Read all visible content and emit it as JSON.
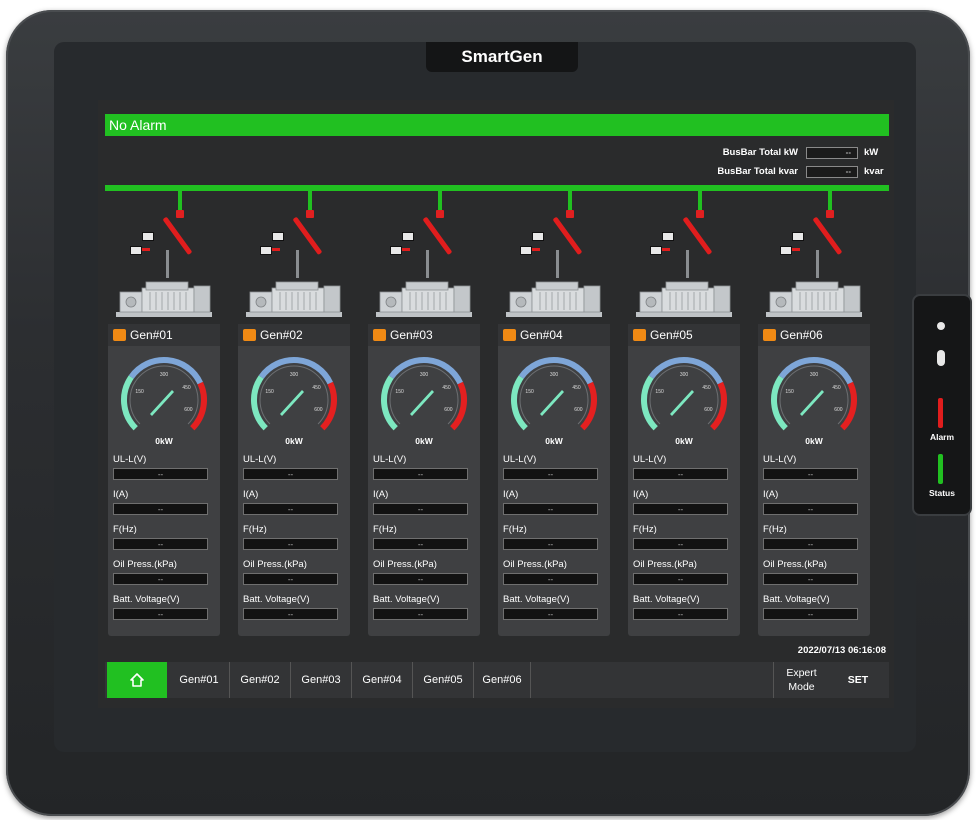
{
  "device": {
    "brand": "SmartGen",
    "side_panel": {
      "alarm_label": "Alarm",
      "status_label": "Status",
      "alarm_color": "#e01d1d",
      "status_color": "#21c021"
    }
  },
  "screen": {
    "alarm_status": "No Alarm",
    "busbar": {
      "total_kw_label": "BusBar Total kW",
      "total_kw_value": "--",
      "total_kw_unit": "kW",
      "total_kvar_label": "BusBar Total kvar",
      "total_kvar_value": "--",
      "total_kvar_unit": "kvar"
    },
    "gauge_ticks": [
      "150",
      "300",
      "450",
      "600"
    ],
    "generators": [
      {
        "name": "Gen#01",
        "power": "0kW",
        "voltage_label": "UL-L(V)",
        "voltage": "--",
        "current_label": "I(A)",
        "current": "--",
        "freq_label": "F(Hz)",
        "freq": "--",
        "oil_label": "Oil Press.(kPa)",
        "oil": "--",
        "batt_label": "Batt. Voltage(V)",
        "batt": "--"
      },
      {
        "name": "Gen#02",
        "power": "0kW",
        "voltage_label": "UL-L(V)",
        "voltage": "--",
        "current_label": "I(A)",
        "current": "--",
        "freq_label": "F(Hz)",
        "freq": "--",
        "oil_label": "Oil Press.(kPa)",
        "oil": "--",
        "batt_label": "Batt. Voltage(V)",
        "batt": "--"
      },
      {
        "name": "Gen#03",
        "power": "0kW",
        "voltage_label": "UL-L(V)",
        "voltage": "--",
        "current_label": "I(A)",
        "current": "--",
        "freq_label": "F(Hz)",
        "freq": "--",
        "oil_label": "Oil Press.(kPa)",
        "oil": "--",
        "batt_label": "Batt. Voltage(V)",
        "batt": "--"
      },
      {
        "name": "Gen#04",
        "power": "0kW",
        "voltage_label": "UL-L(V)",
        "voltage": "--",
        "current_label": "I(A)",
        "current": "--",
        "freq_label": "F(Hz)",
        "freq": "--",
        "oil_label": "Oil Press.(kPa)",
        "oil": "--",
        "batt_label": "Batt. Voltage(V)",
        "batt": "--"
      },
      {
        "name": "Gen#05",
        "power": "0kW",
        "voltage_label": "UL-L(V)",
        "voltage": "--",
        "current_label": "I(A)",
        "current": "--",
        "freq_label": "F(Hz)",
        "freq": "--",
        "oil_label": "Oil Press.(kPa)",
        "oil": "--",
        "batt_label": "Batt. Voltage(V)",
        "batt": "--"
      },
      {
        "name": "Gen#06",
        "power": "0kW",
        "voltage_label": "UL-L(V)",
        "voltage": "--",
        "current_label": "I(A)",
        "current": "--",
        "freq_label": "F(Hz)",
        "freq": "--",
        "oil_label": "Oil Press.(kPa)",
        "oil": "--",
        "batt_label": "Batt. Voltage(V)",
        "batt": "--"
      }
    ],
    "timestamp": "2022/07/13 06:16:08",
    "nav": {
      "home_icon": "home-icon",
      "tabs": [
        "Gen#01",
        "Gen#02",
        "Gen#03",
        "Gen#04",
        "Gen#05",
        "Gen#06"
      ],
      "expert_mode": "Expert Mode",
      "set": "SET"
    },
    "colors": {
      "accent": "#21c021",
      "alarm_red": "#e01d1d",
      "gauge_green": "#7de8c0",
      "gauge_blue": "#7ea6d8",
      "gauge_red": "#e42020",
      "gen_icon": "#f08a14"
    }
  }
}
